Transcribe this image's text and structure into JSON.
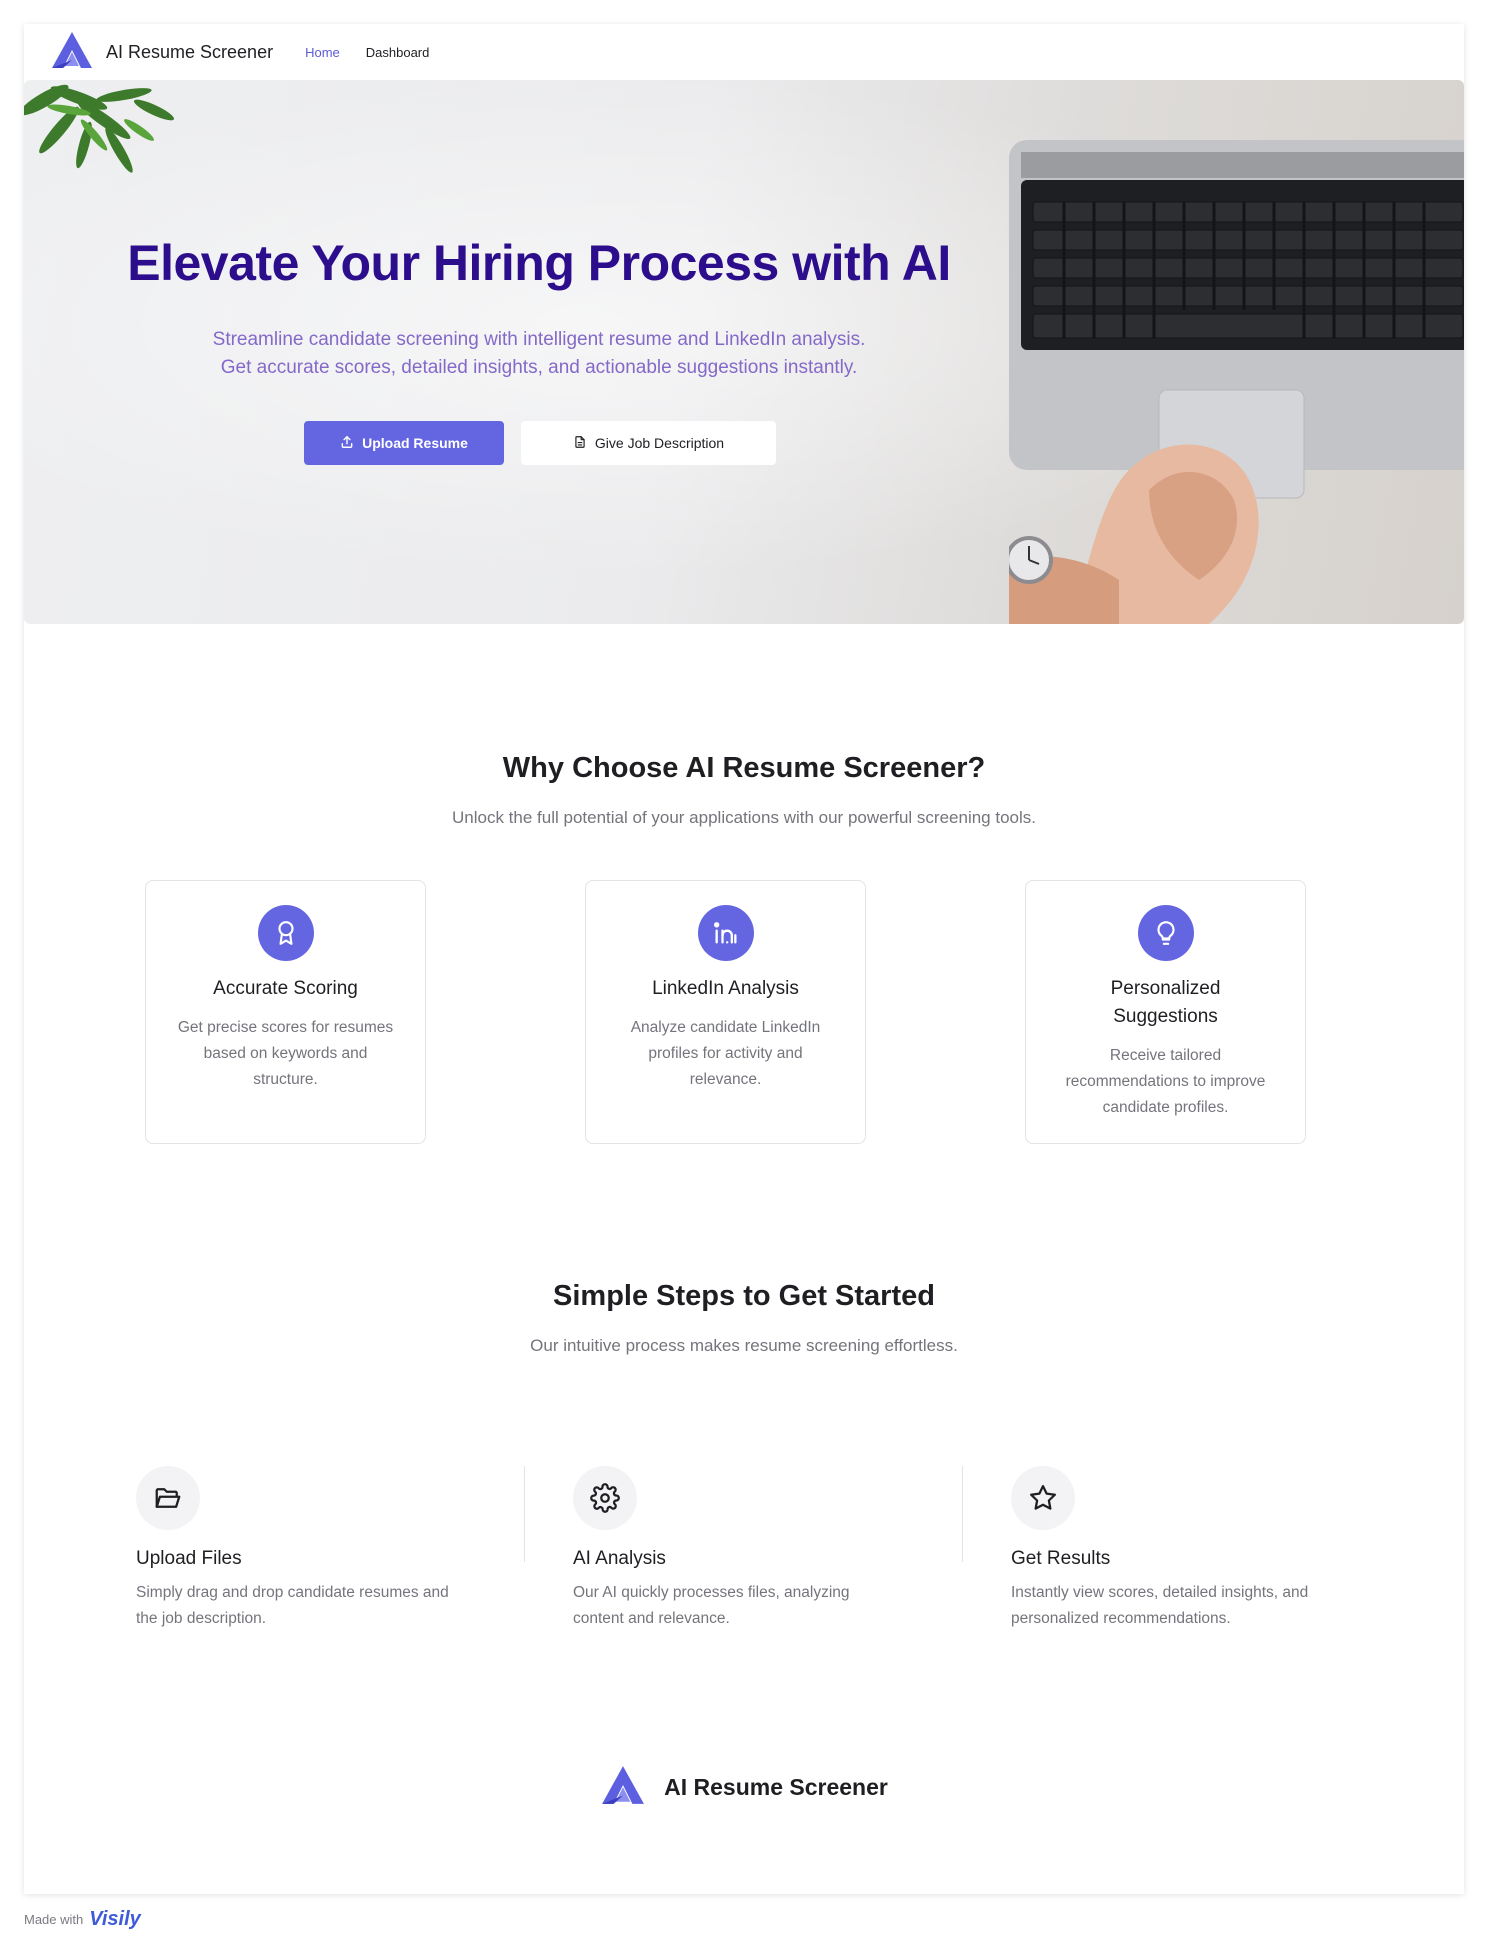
{
  "nav": {
    "brand": "AI Resume Screener",
    "links": [
      {
        "label": "Home",
        "active": true
      },
      {
        "label": "Dashboard",
        "active": false
      }
    ]
  },
  "hero": {
    "title": "Elevate Your Hiring Process with AI",
    "subtitle_line1": "Streamline candidate screening with intelligent resume and LinkedIn analysis.",
    "subtitle_line2": "Get accurate scores, detailed insights, and actionable suggestions instantly.",
    "primary_button": "Upload Resume",
    "secondary_button": "Give Job Description"
  },
  "features": {
    "title": "Why Choose AI Resume Screener?",
    "subtitle": "Unlock the full potential of your applications with our powerful screening tools.",
    "cards": [
      {
        "icon": "award-icon",
        "title": "Accurate Scoring",
        "desc": "Get precise scores for resumes based on keywords and structure."
      },
      {
        "icon": "linkedin-icon",
        "title": "LinkedIn Analysis",
        "desc": "Analyze candidate LinkedIn profiles for activity and relevance."
      },
      {
        "icon": "lightbulb-icon",
        "title": "Personalized Suggestions",
        "desc": "Receive tailored recommendations to improve candidate profiles."
      }
    ]
  },
  "steps": {
    "title": "Simple Steps to Get Started",
    "subtitle": "Our intuitive process makes resume screening effortless.",
    "items": [
      {
        "icon": "folder-open-icon",
        "title": "Upload Files",
        "desc": "Simply drag and drop candidate resumes and the job description."
      },
      {
        "icon": "gear-icon",
        "title": "AI Analysis",
        "desc": "Our AI quickly processes files, analyzing content and relevance."
      },
      {
        "icon": "star-icon",
        "title": "Get Results",
        "desc": "Instantly view scores, detailed insights, and personalized recommendations."
      }
    ]
  },
  "footer": {
    "brand": "AI Resume Screener"
  },
  "badge": {
    "made_with": "Made with",
    "vendor": "Visily"
  },
  "colors": {
    "accent": "#6366e0",
    "hero_title": "#2c0d8c",
    "hero_subtitle": "#8469c8"
  }
}
